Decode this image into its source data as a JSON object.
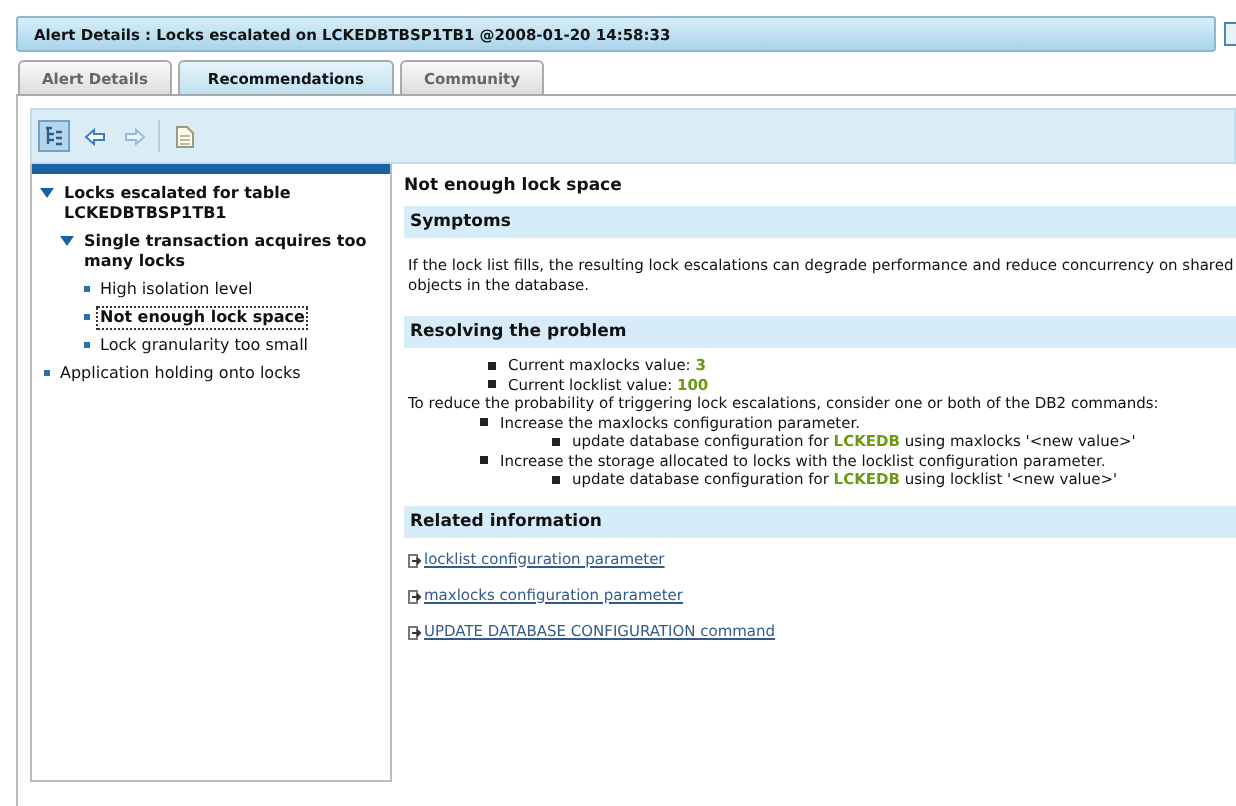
{
  "window": {
    "title": "Alert Details : Locks escalated on LCKEDBTBSP1TB1 @2008-01-20 14:58:33"
  },
  "tabs": [
    {
      "label": "Alert Details",
      "selected": false
    },
    {
      "label": "Recommendations",
      "selected": true
    },
    {
      "label": "Community",
      "selected": false
    }
  ],
  "toolbar": [
    {
      "kind": "tree",
      "selected": true,
      "disabled": false
    },
    {
      "kind": "back",
      "selected": false,
      "disabled": false
    },
    {
      "kind": "forward",
      "selected": false,
      "disabled": true
    },
    {
      "kind": "document",
      "selected": false,
      "disabled": false
    }
  ],
  "tree": [
    {
      "label": "Locks escalated for table LCKEDBTBSP1TB1",
      "expanded": true,
      "selected": false,
      "children": [
        {
          "label": "Single transaction acquires too many locks",
          "expanded": true,
          "selected": false,
          "children": [
            {
              "label": "High isolation level",
              "selected": false
            },
            {
              "label": "Not enough lock space",
              "selected": true
            },
            {
              "label": "Lock granularity too small",
              "selected": false
            }
          ]
        }
      ]
    },
    {
      "label": "Application holding onto locks",
      "selected": false
    }
  ],
  "detail": {
    "title": "Not enough lock space",
    "sections": [
      {
        "kind": "text",
        "heading": "Symptoms",
        "text": "If the lock list fills, the resulting lock escalations can degrade performance and reduce concurrency on shared objects in the database."
      },
      {
        "kind": "resolution",
        "heading": "Resolving the problem",
        "values": [
          {
            "label": "Current maxlocks value:",
            "value": "3"
          },
          {
            "label": "Current locklist value:",
            "value": "100"
          }
        ],
        "intro": "To reduce the probability of triggering lock escalations, consider one or both of the DB2 commands:",
        "steps": [
          {
            "text": "Increase the maxlocks configuration parameter.",
            "children": [
              "update database configuration for **LCKEDB** using maxlocks '<new value>'"
            ]
          },
          {
            "text": "Increase the storage allocated to locks with the locklist configuration parameter.",
            "children": [
              "update database configuration for **LCKEDB** using locklist '<new value>'"
            ]
          }
        ]
      },
      {
        "kind": "links",
        "heading": "Related information",
        "links": [
          "locklist configuration parameter",
          "maxlocks configuration parameter",
          "UPDATE DATABASE CONFIGURATION command"
        ]
      }
    ]
  }
}
